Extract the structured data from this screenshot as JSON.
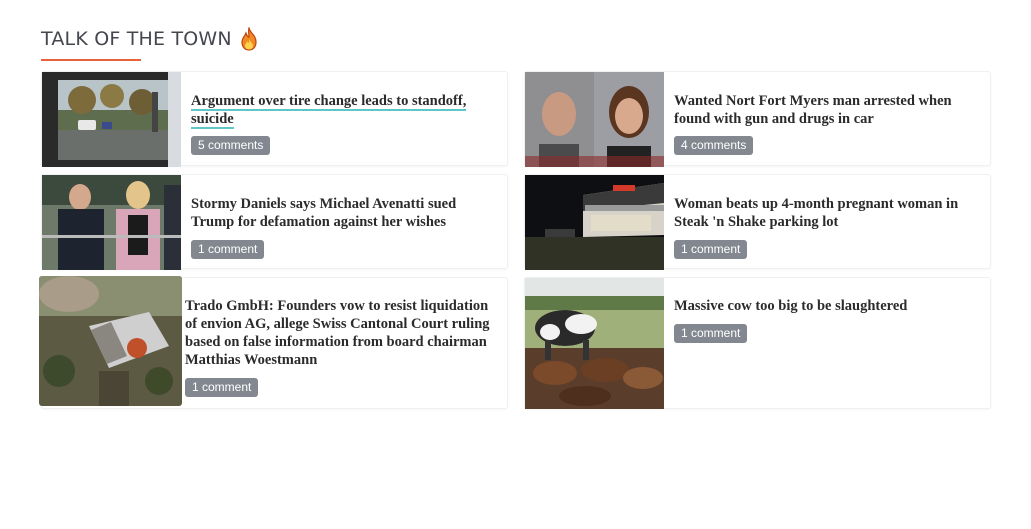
{
  "section": {
    "title": "TALK OF THE TOWN",
    "icon": "fire-icon",
    "accent_color": "#e8623b"
  },
  "articles": [
    {
      "title": "Argument over tire change leads to standoff, suicide",
      "comments": "5 comments",
      "image": "police-scene-thumbnail",
      "hovered": true
    },
    {
      "title": "Wanted Nort Fort Myers man arrested when found with gun and drugs in car",
      "comments": "4 comments",
      "image": "mugshots-thumbnail"
    },
    {
      "title": "Stormy Daniels says Michael Avenatti sued Trump for defamation against her wishes",
      "comments": "1 comment",
      "image": "press-crowd-thumbnail"
    },
    {
      "title": "Woman beats up 4-month pregnant woman in Steak 'n Shake parking lot",
      "comments": "1 comment",
      "image": "restaurant-night-thumbnail"
    },
    {
      "title": "Trado GmbH: Founders vow to resist liquidation of envion AG, allege Swiss Cantonal Court ruling based on false information from board chairman Matthias Woestmann",
      "comments": "1 comment",
      "image": "house-fire-aerial-thumbnail"
    },
    {
      "title": "Massive cow too big to be slaughtered",
      "comments": "1 comment",
      "image": "cattle-herd-thumbnail"
    }
  ]
}
